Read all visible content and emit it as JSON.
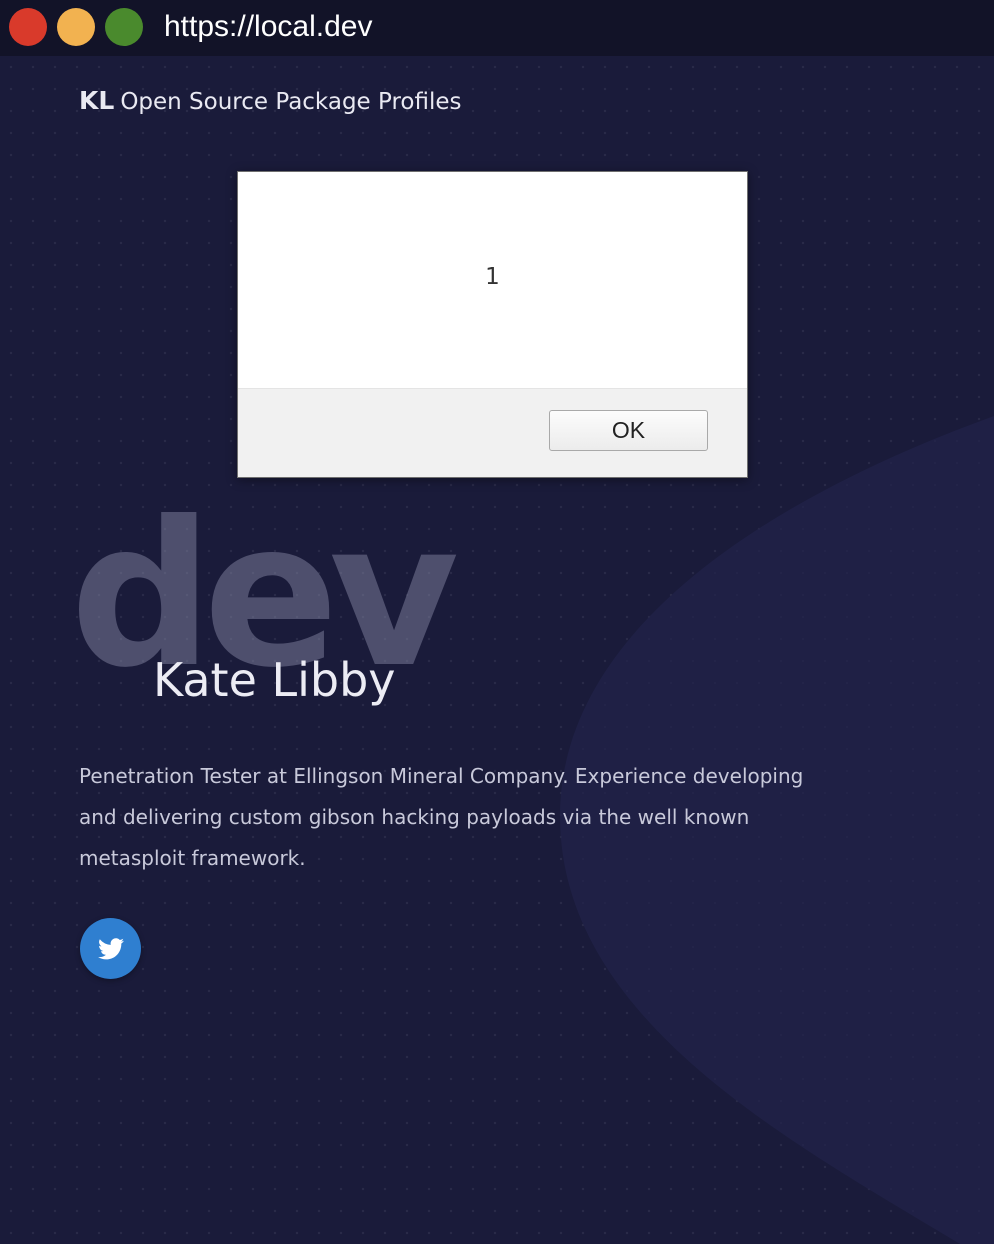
{
  "browser": {
    "url": "https://local.dev"
  },
  "header": {
    "brand_initials": "KL",
    "brand_title": "Open Source Package Profiles"
  },
  "hero": {
    "watermark": "dev",
    "name": "Kate Libby",
    "bio": "Penetration Tester at Ellingson Mineral Company. Experience developing and delivering custom gibson hacking payloads via the well known metasploit framework."
  },
  "social": {
    "icon": "twitter-icon"
  },
  "alert": {
    "message": "1",
    "ok_label": "OK"
  },
  "colors": {
    "background": "#1a1b3a",
    "twitter": "#2f7fd0",
    "traffic_red": "#d93a2b",
    "traffic_yellow": "#f2b250",
    "traffic_green": "#4a8a2d"
  }
}
